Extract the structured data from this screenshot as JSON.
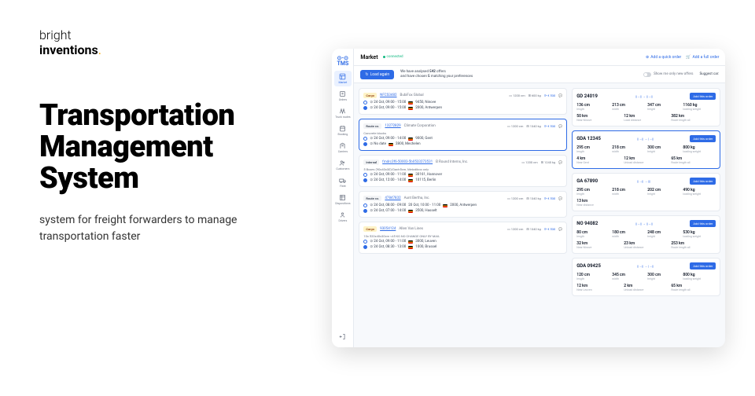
{
  "brand": {
    "line1": "bright",
    "line2": "inventions",
    "dot": "."
  },
  "hero": {
    "title1": "Transportation",
    "title2": "Management",
    "title3": "System",
    "subtitle": "system for freight forwarders to manage transportation faster"
  },
  "app": {
    "logo": "TMS",
    "sidebar": [
      {
        "label": "Market",
        "active": true
      },
      {
        "label": "Orders"
      },
      {
        "label": "Truck routes"
      },
      {
        "label": "Booking"
      },
      {
        "label": "Carriers"
      },
      {
        "label": "Customers"
      },
      {
        "label": "Fleet"
      },
      {
        "label": "Dispositions"
      },
      {
        "label": "Drivers"
      }
    ],
    "topbar": {
      "title": "Market",
      "status": "connected",
      "quick": "Add a quick order",
      "full": "Add a full order"
    },
    "filterbar": {
      "load": "Load again",
      "msg_pre": "We have analysed ",
      "msg_count": "542",
      "msg_mid": " offers",
      "msg2_pre": "and have chosen ",
      "msg2_count": "5",
      "msg2_post": " matching your preferences",
      "toggle": "Show me only new offers",
      "suggest": "Suggest car:"
    },
    "offers": [
      {
        "type": "Cargo",
        "id": "NFCS3482",
        "company": "BubiFox Global",
        "meta1": "1200 cm",
        "meta2": "600 kg",
        "price": "€ 530",
        "from": "24 Oct, 09:00 - 15:00",
        "from_loc": "9450, Ninove",
        "to": "24 Oct, 09:00 - 15:00",
        "to_loc": "2000, Antwerpen"
      },
      {
        "type": "Route co.",
        "id": "13272829",
        "company": "Climate Corporation",
        "hl": true,
        "meta1": "1200 cm",
        "meta2": "1340 kg",
        "price": "€ 530",
        "note": "Concrete blocks",
        "from": "24 Oct, 09:00 - 14:00",
        "from_loc": "9000, Gent",
        "to": "No date",
        "to_loc": "2800, Mechelen"
      },
      {
        "type": "Internal",
        "id": "fmdrc3f6-50003-5b0533273531",
        "company": "B Round Interns, Inc.",
        "meta1": "1200 cm",
        "meta2": "1240 kg",
        "note": "5 Boxes (90x40x30)/Dach5cm, Melodibox only",
        "from": "24 Oct, 09:00 - 11:00",
        "from_loc": "30161, Hannover",
        "to": "24 Oct, 12:00 - 14:00",
        "to_loc": "10115, Berlin"
      },
      {
        "type": "Route co.",
        "id": "47847832",
        "company": "Aunt Bertha, Inc.",
        "meta1": "1200 cm",
        "meta2": "1340 kg",
        "price": "€ 530",
        "from": "24 Oct, 08:00 - 09:00",
        "from_mid": "20 Oct, 10:00 - 11:00",
        "from_loc": "2000, Antwerpen",
        "to": "24 Oct, 07:00 - 14:00",
        "to_loc": "3500, Hasselt"
      },
      {
        "type": "Cargo",
        "id": "93054124",
        "company": "Allen Van Lines",
        "meta1": "1200 cm",
        "meta2": "1340 kg",
        "price": "€ 530",
        "note": "10x 520x40x30cm <45 KG NO CHANGE ONLY BY MAIL",
        "from": "24 Oct, 09:00 - 11:00",
        "from_loc": "3000, Leuven",
        "to": "24 Oct, 08:30 - 13:00",
        "to_loc": "1000, Brussel"
      }
    ],
    "suggestions": [
      {
        "title": "GD 24019",
        "link": "||→|| → ||→||",
        "hl": false,
        "stats": [
          {
            "v": "136 cm",
            "l": "length"
          },
          {
            "v": "213 cm",
            "l": "width"
          },
          {
            "v": "347 cm",
            "l": "height"
          },
          {
            "v": "1160 kg",
            "l": "loading weight"
          }
        ],
        "stats2": [
          {
            "v": "50 km",
            "l": "Near Ninove"
          },
          {
            "v": "12 km",
            "l": "Load distance"
          },
          {
            "v": "382 km",
            "l": "Route length all"
          }
        ]
      },
      {
        "title": "GDA 12345",
        "link": "||→|| → |→||",
        "hl": true,
        "stats": [
          {
            "v": "295 cm",
            "l": "length"
          },
          {
            "v": "218 cm",
            "l": "width"
          },
          {
            "v": "300 cm",
            "l": "height"
          },
          {
            "v": "800 kg",
            "l": "loading weight"
          }
        ],
        "stats2": [
          {
            "v": "4 km",
            "l": "Near Gent"
          },
          {
            "v": "12 km",
            "l": "Unload distance"
          },
          {
            "v": "65 km",
            "l": "Route length all"
          }
        ]
      },
      {
        "title": "GA 67890",
        "link": "||→|| → |||",
        "stats": [
          {
            "v": "295 cm",
            "l": "length"
          },
          {
            "v": "218 cm",
            "l": "width"
          },
          {
            "v": "202 cm",
            "l": "height"
          },
          {
            "v": "490 kg",
            "l": "loading weight"
          }
        ],
        "stats2": [
          {
            "v": "13 km",
            "l": "Near distance"
          }
        ]
      },
      {
        "title": "NO 94082",
        "link": "||→|| → ||→||",
        "stats": [
          {
            "v": "80 cm",
            "l": "length"
          },
          {
            "v": "180 cm",
            "l": "width"
          },
          {
            "v": "248 cm",
            "l": "height"
          },
          {
            "v": "530 kg",
            "l": "loading weight"
          }
        ],
        "stats2": [
          {
            "v": "32 km",
            "l": "Near Ninove"
          },
          {
            "v": "23 km",
            "l": "Unload distance"
          },
          {
            "v": "253 km",
            "l": "Route length all"
          }
        ]
      },
      {
        "title": "GDA 09425",
        "link": "||→|| → |→||",
        "stats": [
          {
            "v": "120 cm",
            "l": "length"
          },
          {
            "v": "345 cm",
            "l": "width"
          },
          {
            "v": "300 cm",
            "l": "height"
          },
          {
            "v": "800 kg",
            "l": "loading weight"
          }
        ],
        "stats2": [
          {
            "v": "12 km",
            "l": "Near Leuven"
          },
          {
            "v": "2 km",
            "l": "Unload distance"
          },
          {
            "v": "65 km",
            "l": "Route length all"
          }
        ]
      }
    ],
    "add_btn": "Add this order"
  }
}
